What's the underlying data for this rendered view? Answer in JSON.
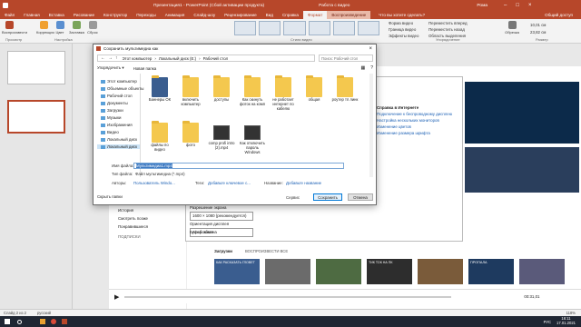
{
  "app": {
    "title": "Презентация1 - PowerPoint (Сбой активации продукта)",
    "context_label": "Работа с видео",
    "user": "Рома",
    "tabs": [
      "Файл",
      "Главная",
      "Вставка",
      "Рисование",
      "Конструктор",
      "Переходы",
      "Анимация",
      "Слайд-шоу",
      "Рецензирование",
      "Вид",
      "Справка",
      "Формат",
      "Воспроизведение"
    ],
    "active_tab": "Формат",
    "tell_me": "Что вы хотите сделать?",
    "share": "Общий доступ"
  },
  "ribbon": {
    "buttons": [
      "Воспроизвести",
      "Коррекция",
      "Цвет",
      "Заставка",
      "Сброс"
    ],
    "groups": [
      "Просмотр",
      "Настройка",
      "Стили видео",
      "Упорядочение",
      "Размер"
    ],
    "right_items": [
      "Форма видео",
      "Граница видео",
      "Эффекты видео",
      "Переместить вперед",
      "Переместить назад",
      "Область выделения",
      "Обрезка"
    ],
    "size_h": "10,01 см",
    "size_w": "23,82 см"
  },
  "save_dialog": {
    "title": "Сохранить мультимедиа как",
    "path": [
      "Этот компьютер",
      "Локальный диск (E:)",
      "Рабочий стол"
    ],
    "search_placeholder": "Поиск: Рабочий стол",
    "organize": "Упорядочить ▾",
    "new_folder": "Новая папка",
    "nav": [
      "Этот компьютер",
      "Объемные объекты",
      "Рабочий стол",
      "Документы",
      "Загрузки",
      "Музыки",
      "Изображения",
      "Видео",
      "Локальный диск",
      "Локальный диск"
    ],
    "files": [
      {
        "name": "Баннеры ОК",
        "kind": "folder"
      },
      {
        "name": "включить компьютер",
        "kind": "folder"
      },
      {
        "name": "доступы",
        "kind": "folder"
      },
      {
        "name": "Как скинуть фоток на комп",
        "kind": "folder"
      },
      {
        "name": "не работает интернет по кабелю",
        "kind": "folder"
      },
      {
        "name": "общая",
        "kind": "folder"
      },
      {
        "name": "роутер тп линк",
        "kind": "folder"
      },
      {
        "name": "файлы по видео",
        "kind": "folder"
      },
      {
        "name": "фото",
        "kind": "folder"
      },
      {
        "name": "comp profi intro (2).mp4",
        "kind": "video"
      },
      {
        "name": "Как отключить пароль Windows",
        "kind": "video"
      }
    ],
    "file_name_label": "Имя файла:",
    "file_name_value": "Мультимедиа1.mp4",
    "file_type_label": "Тип файла:",
    "file_type_value": "Файл мультимедиа (*.mp4)",
    "authors_label": "Авторы:",
    "authors_value": "Пользователь Windo...",
    "tags_label": "Теги:",
    "tags_value": "Добавьте ключевое с...",
    "title_label": "Название:",
    "title_value": "Добавьте название",
    "service": "Сервис",
    "save": "Сохранить",
    "cancel": "Отмена",
    "hide_folders": "Скрыть папки"
  },
  "background": {
    "settings_related_title": "Справка в Интернете",
    "settings_links": [
      "Подключение к беспроводному дисплею",
      "Настройка нескольких мониторов",
      "Изменение цветов",
      "Изменение размера шрифта"
    ],
    "settings_items": [
      "Разрешение экрана",
      "1600 × 1080 (рекомендуется)",
      "Ориентация дисплея",
      "Альбомная",
      "Общие возможности",
      "Буфер обмена"
    ],
    "yt_side": [
      "Главная",
      "Навигатор",
      "Подписки",
      "Библиотека",
      "История",
      "Смотреть позже",
      "Понравившиеся"
    ],
    "subs_header": "ПОДПИСКИ",
    "downloads": "Загрузки",
    "autoplay": "ВОСПРОИЗВЕСТИ ВСЕ",
    "strip_titles": [
      "КАК РАСКАЗАТЬ ГЛОВЕТ",
      "ТИК ТОК НА ПК",
      "ПРОПАЛА"
    ],
    "time": "00:31,01"
  },
  "status": {
    "slide": "Слайд 2 из 2",
    "lang": "русский",
    "zoom": "118%"
  },
  "taskbar": {
    "clock": "16:11",
    "date": "17.01.2021",
    "lang": "РУС"
  },
  "colors": {
    "accent": "#b7472a",
    "link": "#1a5fb4"
  }
}
